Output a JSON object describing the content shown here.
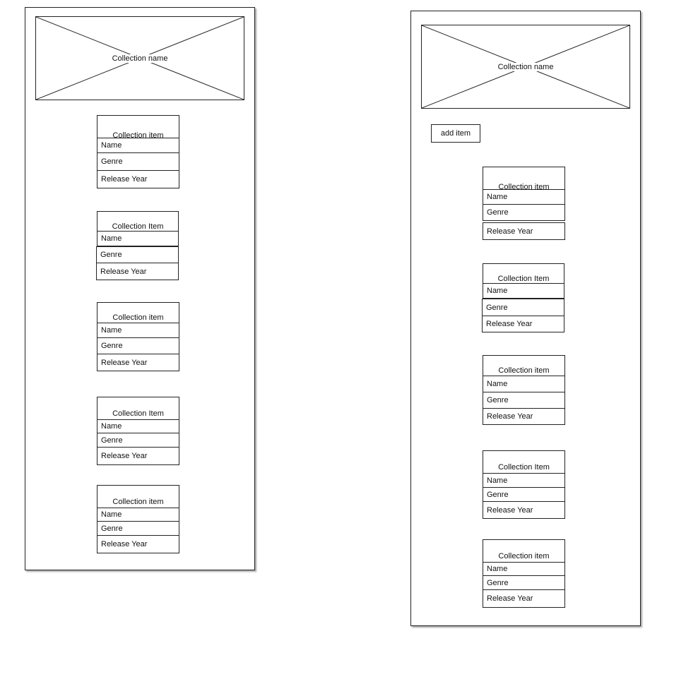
{
  "left_screen": {
    "header_placeholder_label": "Collection name",
    "items": [
      {
        "title": "Collection item",
        "fields": [
          "Name",
          "Genre",
          "Release Year"
        ]
      },
      {
        "title": "Collection Item",
        "fields": [
          "Name",
          "Genre",
          "Release Year"
        ]
      },
      {
        "title": "Collection item",
        "fields": [
          "Name",
          "Genre",
          "Release Year"
        ]
      },
      {
        "title": "Collection Item",
        "fields": [
          "Name",
          "Genre",
          "Release Year"
        ]
      },
      {
        "title": "Collection item",
        "fields": [
          "Name",
          "Genre",
          "Release Year"
        ]
      }
    ]
  },
  "right_screen": {
    "header_placeholder_label": "Collection name",
    "add_button_label": "add item",
    "items": [
      {
        "title": "Collection item",
        "fields": [
          "Name",
          "Genre",
          "Release Year"
        ]
      },
      {
        "title": "Collection Item",
        "fields": [
          "Name",
          "Genre",
          "Release Year"
        ]
      },
      {
        "title": "Collection item",
        "fields": [
          "Name",
          "Genre",
          "Release Year"
        ]
      },
      {
        "title": "Collection Item",
        "fields": [
          "Name",
          "Genre",
          "Release Year"
        ]
      },
      {
        "title": "Collection item",
        "fields": [
          "Name",
          "Genre",
          "Release Year"
        ]
      }
    ]
  }
}
